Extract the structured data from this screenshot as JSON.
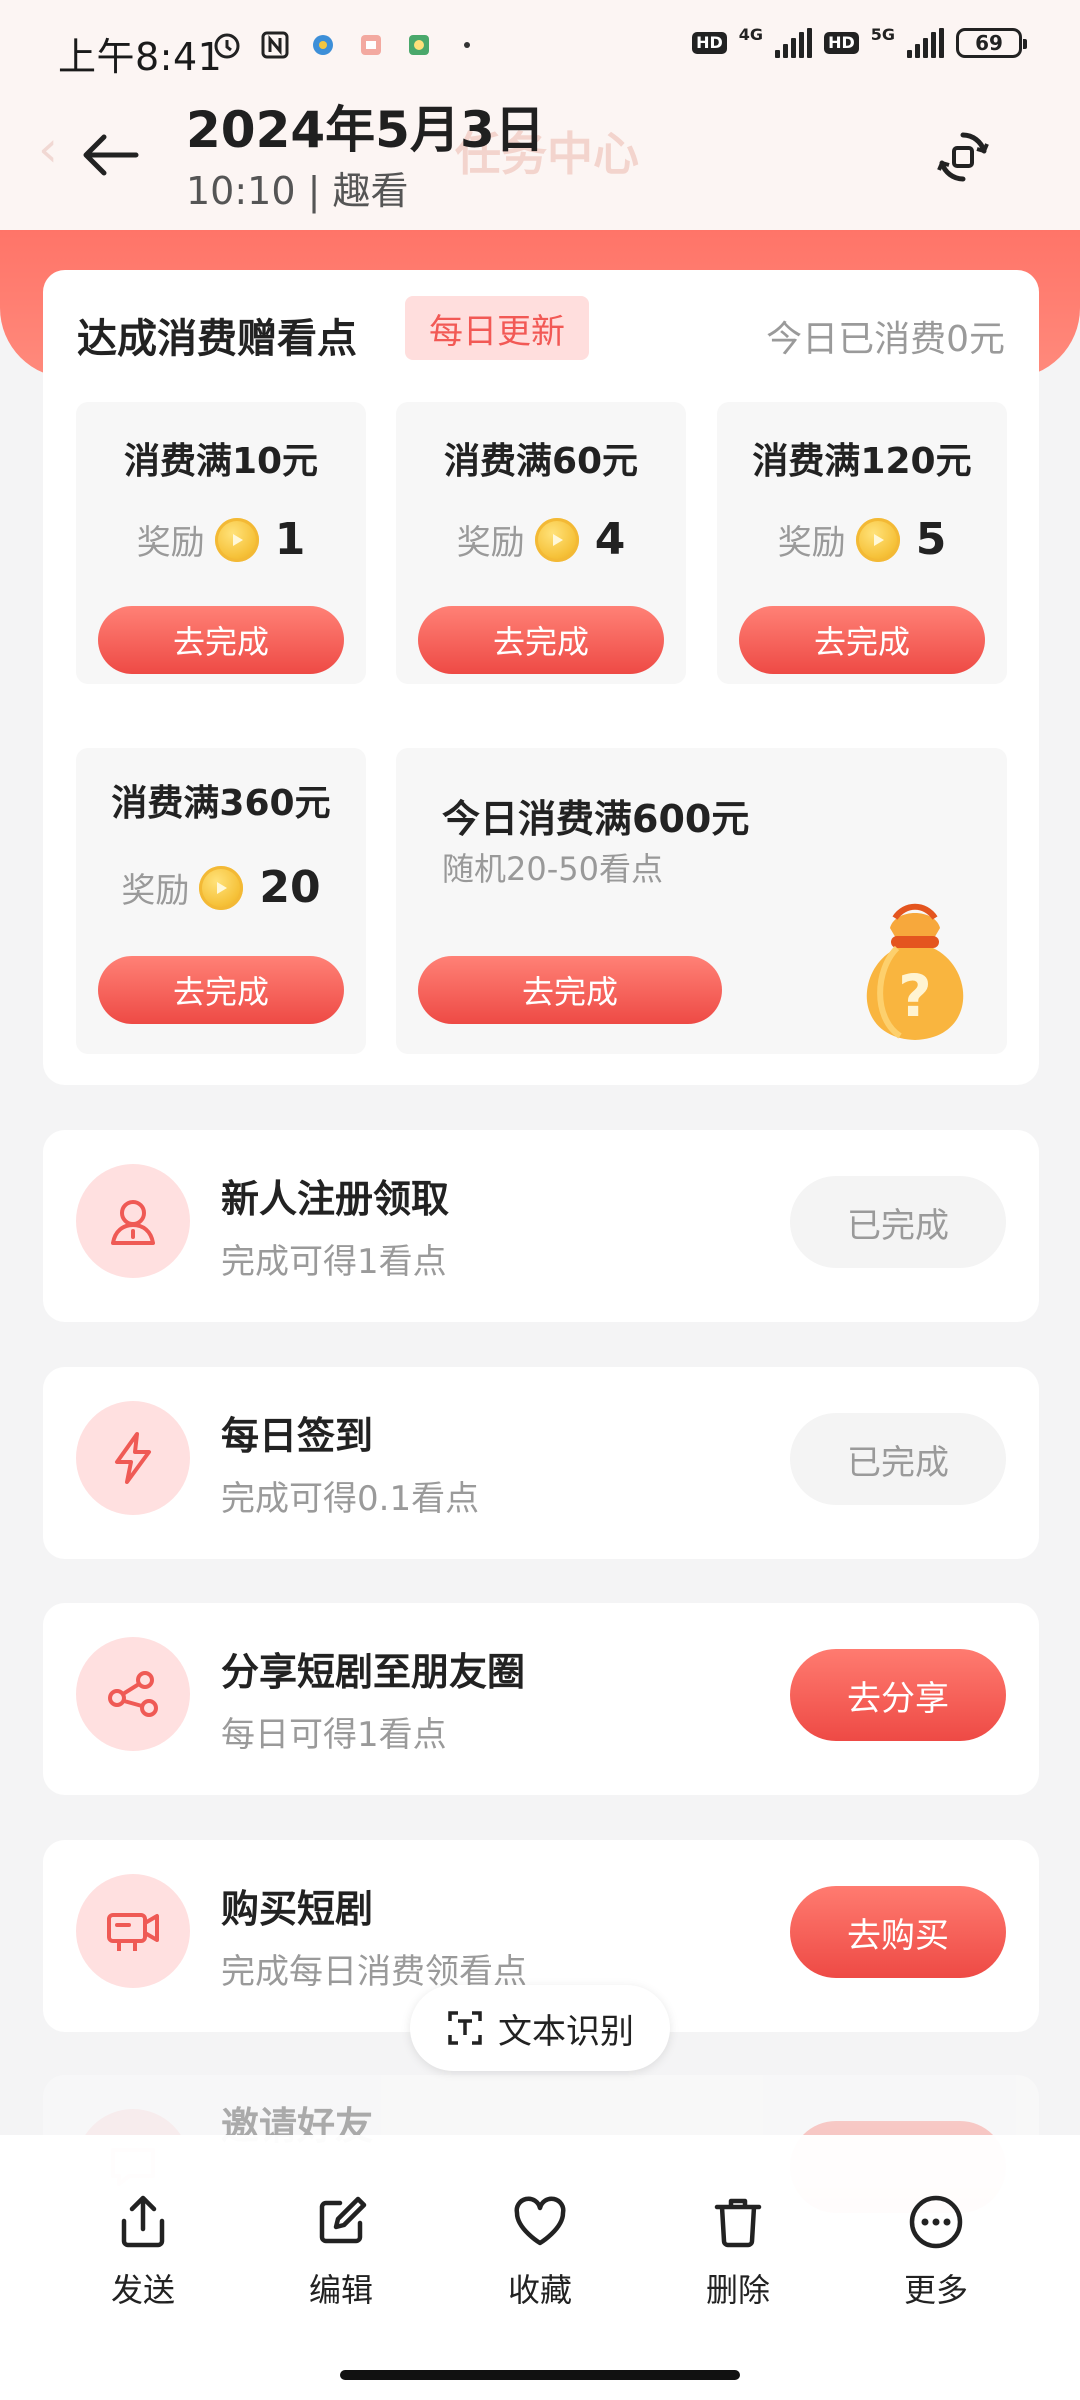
{
  "status_bar": {
    "time": "上午8:41",
    "net1": "4G",
    "net2": "5G",
    "hd": "HD",
    "battery": "69"
  },
  "header": {
    "date": "2024年5月3日",
    "subtitle": "10:10 | 趣看",
    "bg_title": "任务中心"
  },
  "consume": {
    "title": "达成消费赠看点",
    "tag": "每日更新",
    "today_spent": "今日已消费0元",
    "reward_label": "奖励",
    "button_label": "去完成",
    "tiers": [
      {
        "name": "消费满10元",
        "reward": "1"
      },
      {
        "name": "消费满60元",
        "reward": "4"
      },
      {
        "name": "消费满120元",
        "reward": "5"
      },
      {
        "name": "消费满360元",
        "reward": "20"
      }
    ],
    "big_tier": {
      "name": "今日消费满600元",
      "desc": "随机20-50看点"
    }
  },
  "tasks": [
    {
      "title": "新人注册领取",
      "desc": "完成可得1看点",
      "button": "已完成",
      "done": true,
      "icon": "user-icon"
    },
    {
      "title": "每日签到",
      "desc": "完成可得0.1看点",
      "button": "已完成",
      "done": true,
      "icon": "lightning-icon"
    },
    {
      "title": "分享短剧至朋友圈",
      "desc": "每日可得1看点",
      "button": "去分享",
      "done": false,
      "icon": "share-icon"
    },
    {
      "title": "购买短剧",
      "desc": "完成每日消费领看点",
      "button": "去购买",
      "done": false,
      "icon": "video-camera-icon"
    },
    {
      "title": "邀请好友",
      "desc": "",
      "button": "",
      "done": false,
      "icon": "chat-icon"
    }
  ],
  "ocr_pill": {
    "label": "文本识别"
  },
  "bottom_actions": [
    {
      "label": "发送",
      "icon": "send-icon"
    },
    {
      "label": "编辑",
      "icon": "edit-icon"
    },
    {
      "label": "收藏",
      "icon": "heart-icon"
    },
    {
      "label": "删除",
      "icon": "trash-icon"
    },
    {
      "label": "更多",
      "icon": "more-icon"
    }
  ],
  "colors": {
    "accent": "#f25955",
    "band": "#ff7468",
    "button_gradient_top": "#ff8176",
    "button_gradient_bottom": "#ee4a45",
    "icon_bg": "#ffe0e0"
  }
}
